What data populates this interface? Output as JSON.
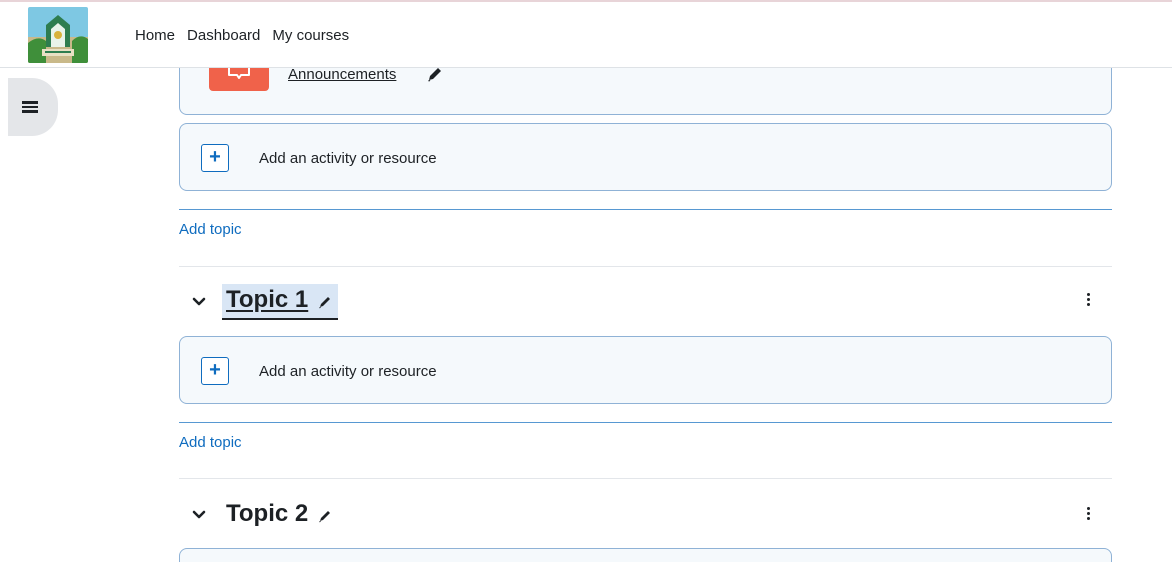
{
  "nav": {
    "links": [
      "Home",
      "Dashboard",
      "My courses"
    ]
  },
  "activities": {
    "announcements": "Announcements",
    "add_activity_1": "Add an activity or resource",
    "add_activity_2": "Add an activity or resource"
  },
  "add_topic": "Add topic",
  "sections": [
    {
      "title": "Topic 1"
    },
    {
      "title": "Topic 2"
    }
  ],
  "colors": {
    "accent": "#0f6cbf",
    "forum": "#f0624a",
    "card_bg": "#f5f9fc",
    "highlight": "#d9e6f5"
  }
}
